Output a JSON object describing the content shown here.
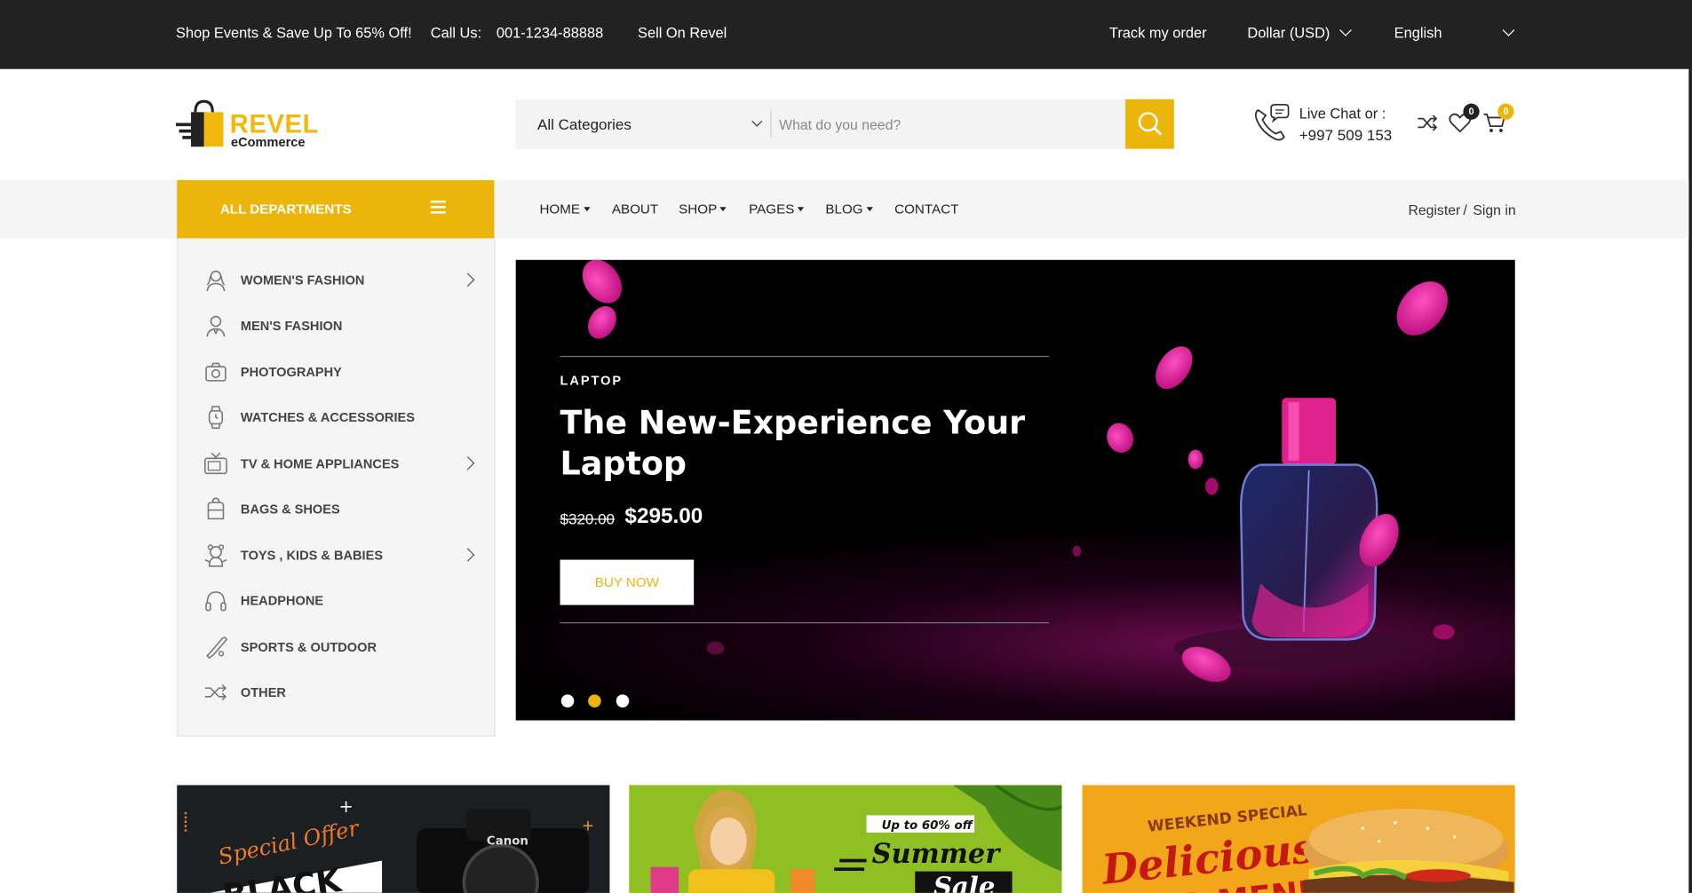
{
  "topbar": {
    "promo": "Shop Events & Save Up To 65% Off!",
    "call_label": "Call Us:",
    "phone": "001-1234-88888",
    "sell": "Sell On Revel",
    "track": "Track my order",
    "currency": "Dollar (USD)",
    "language": "English"
  },
  "header": {
    "logo_brand": "REVEL",
    "logo_sub": "eCommerce",
    "category_select": "All Categories",
    "search_placeholder": "What do you need?",
    "live_chat_label": "Live Chat or :",
    "live_chat_phone": "+997 509 153",
    "wishlist_count": "0",
    "cart_count": "0"
  },
  "nav": {
    "all_departments": "ALL DEPARTMENTS",
    "links": [
      "HOME",
      "ABOUT",
      "SHOP",
      "PAGES",
      "BLOG",
      "CONTACT"
    ],
    "register": "Register",
    "separator": "/",
    "signin": "Sign in"
  },
  "sidebar": {
    "items": [
      {
        "label": "WOMEN'S FASHION",
        "icon": "woman-icon",
        "has_sub": true
      },
      {
        "label": "MEN'S FASHION",
        "icon": "man-icon",
        "has_sub": false
      },
      {
        "label": "PHOTOGRAPHY",
        "icon": "camera-icon",
        "has_sub": false
      },
      {
        "label": "WATCHES & ACCESSORIES",
        "icon": "watch-icon",
        "has_sub": false
      },
      {
        "label": "TV & HOME APPLIANCES",
        "icon": "tv-icon",
        "has_sub": true
      },
      {
        "label": "BAGS & SHOES",
        "icon": "bag-icon",
        "has_sub": false
      },
      {
        "label": "TOYS , KIDS & BABIES",
        "icon": "toy-icon",
        "has_sub": true
      },
      {
        "label": "HEADPHONE",
        "icon": "headphone-icon",
        "has_sub": false
      },
      {
        "label": "SPORTS & OUTDOOR",
        "icon": "bat-icon",
        "has_sub": false
      },
      {
        "label": "OTHER",
        "icon": "shuffle-icon",
        "has_sub": false
      }
    ]
  },
  "hero": {
    "tag": "LAPTOP",
    "title": "The New-Experience Your Laptop",
    "old_price": "$320.00",
    "new_price": "$295.00",
    "button": "BUY NOW",
    "active_slide": 2
  },
  "banners": [
    {
      "line1": "Special Offer",
      "line2": "BLACK",
      "brand": "Canon",
      "bg": "#1c1f22"
    },
    {
      "line1": "Up to 60% off",
      "line2": "Summer",
      "line3": "Sale",
      "bg": "#8fbf22"
    },
    {
      "line1": "WEEKEND SPECIAL",
      "line2": "Delicious",
      "line3": "FOOD MENU",
      "bg": "#f2a619"
    }
  ],
  "colors": {
    "accent": "#ebb50a",
    "dark": "#222222",
    "light_bg": "#f5f5f5"
  }
}
